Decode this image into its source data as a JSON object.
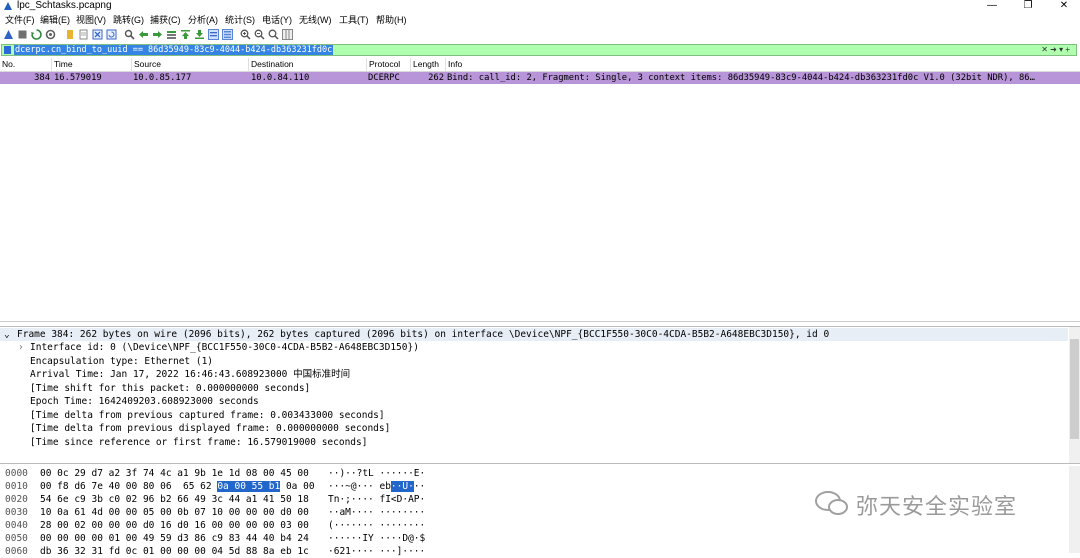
{
  "window": {
    "title": "lpc_Schtasks.pcapng",
    "controls": [
      "—",
      "❐",
      "✕"
    ]
  },
  "menu": [
    "文件(F)",
    "编辑(E)",
    "视图(V)",
    "跳转(G)",
    "捕获(C)",
    "分析(A)",
    "统计(S)",
    "电话(Y)",
    "无线(W)",
    "工具(T)",
    "帮助(H)"
  ],
  "filter": {
    "value": "dcerpc.cn_bind_to_uuid == 86d35949-83c9-4044-b424-db363231fd0c",
    "right_controls": "✕  ➜  ▾  +"
  },
  "packet_list": {
    "columns": [
      "No.",
      "Time",
      "Source",
      "Destination",
      "Protocol",
      "Length",
      "Info"
    ],
    "rows": [
      {
        "no": "384",
        "time": "16.579019",
        "source": "10.0.85.177",
        "destination": "10.0.84.110",
        "protocol": "DCERPC",
        "length": "262",
        "info": "Bind: call_id: 2, Fragment: Single, 3 context items: 86d35949-83c9-4044-b424-db363231fd0c V1.0 (32bit NDR), 86…"
      }
    ]
  },
  "details": {
    "frame": "Frame 384: 262 bytes on wire (2096 bits), 262 bytes captured (2096 bits) on interface \\Device\\NPF_{BCC1F550-30C0-4CDA-B5B2-A648EBC3D150}, id 0",
    "lines": [
      "Interface id: 0 (\\Device\\NPF_{BCC1F550-30C0-4CDA-B5B2-A648EBC3D150})",
      "Encapsulation type: Ethernet (1)",
      "Arrival Time: Jan 17, 2022 16:46:43.608923000 中国标准时间",
      "[Time shift for this packet: 0.000000000 seconds]",
      "Epoch Time: 1642409203.608923000 seconds",
      "[Time delta from previous captured frame: 0.003433000 seconds]",
      "[Time delta from previous displayed frame: 0.000000000 seconds]",
      "[Time since reference or first frame: 16.579019000 seconds]"
    ]
  },
  "bytes": [
    {
      "offset": "0000",
      "hex": "00 0c 29 d7 a2 3f 74 4c  a1 9b 1e 1d 08 00 45 00",
      "ascii": "··)··?tL ······E·"
    },
    {
      "offset": "0010",
      "hex_pre": "00 f8 d6 7e 40 00 80 06  65 62 ",
      "hex_hl": "0a 00 55 b1",
      "hex_post": " 0a 00",
      "ascii_pre": "···~@··· eb",
      "ascii_hl": "··U·",
      "ascii_post": "··"
    },
    {
      "offset": "0020",
      "hex": "54 6e c9 3b c0 02 96 b2  66 49 3c 44 a1 41 50 18",
      "ascii": "Tn·;···· fI<D·AP·"
    },
    {
      "offset": "0030",
      "hex": "10 0a 61 4d 00 00 05 00  0b 07 10 00 00 00 d0 00",
      "ascii": "··aM···· ········"
    },
    {
      "offset": "0040",
      "hex": "28 00 02 00 00 00 d0 16  d0 16 00 00 00 00 03 00",
      "ascii": "(······· ········"
    },
    {
      "offset": "0050",
      "hex": "00 00 00 00 01 00 49 59  d3 86 c9 83 44 40 b4 24",
      "ascii": "······IY ····D@·$"
    },
    {
      "offset": "0060",
      "hex": "db 36 32 31 fd 0c 01 00  00 00 04 5d 88 8a eb 1c",
      "ascii": "·621···· ···]····"
    }
  ],
  "watermark": {
    "text": "弥天安全实验室"
  },
  "colors": {
    "filter_bg": "#afffaf",
    "selected_row": "#b895d8",
    "byte_highlight": "#2266cc"
  }
}
